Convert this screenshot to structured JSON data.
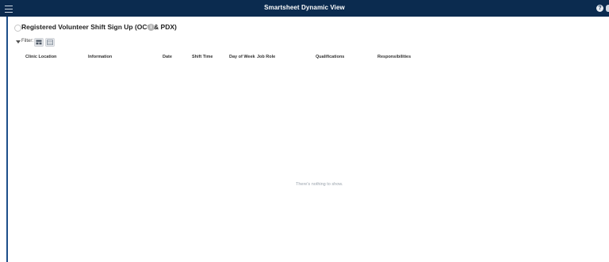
{
  "app": {
    "title": "Smartsheet Dynamic View",
    "help_icon_text": "?",
    "info_icon_text": "i"
  },
  "view": {
    "title": "Registered Volunteer Shift Sign Up (OCC & PDX)"
  },
  "filter": {
    "label": "Filter:"
  },
  "table": {
    "columns": [
      "Clinic Location",
      "Information",
      "Date",
      "Shift Time",
      "Day of Week",
      "Job Role",
      "Qualifications",
      "Responsibilities"
    ],
    "empty_message": "There's nothing to show."
  },
  "colors": {
    "topbar": "#0b2b4f",
    "accent": "#1d4e89"
  }
}
